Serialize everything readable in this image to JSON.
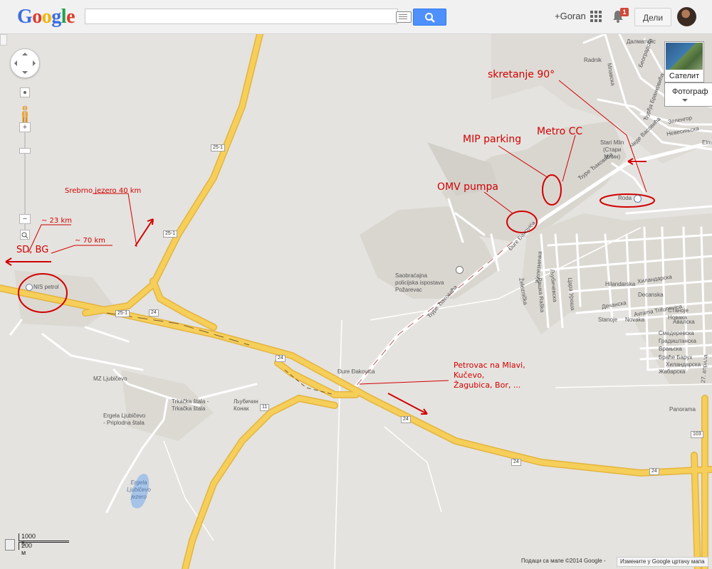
{
  "header": {
    "logo": [
      "G",
      "o",
      "o",
      "g",
      "l",
      "e"
    ],
    "logo_colors": [
      "#3b6ee0",
      "#dd3c2c",
      "#f2b400",
      "#3b6ee0",
      "#1ea34b",
      "#dd3c2c"
    ],
    "search_value": "",
    "profile": "+Goran",
    "notification_count": "1",
    "share_label": "Дели"
  },
  "controls": {
    "zoom_in": "+",
    "zoom_out": "−",
    "satellite_label": "Сателит",
    "photos_label": "Фотограф",
    "scale_imperial": "1000 ft",
    "scale_metric": "200 м"
  },
  "map_labels": {
    "radnik": "Radnik",
    "dalmatinska": "Далматинс",
    "mlavska": "Млавска",
    "beogradska": "Београдска",
    "jure_brankovica": "Ђурђа Бранковића",
    "stari_mlin": "Stari Mlin\n(Стари\nМлин)",
    "cede_vasovica": "Чеде Васовића",
    "nevesinjska": "Невесињска",
    "zelengorska": "Зеленгор",
    "elm": "Elm",
    "roda": "Roda",
    "ture_jakovica_1": "Ђуре Ђаковића",
    "ture_jakovica_2": "Đure Đakovića",
    "ture_jakovica_3": "Ђуре Ђаковића",
    "ture_jakovica_4": "Đure Đakovića",
    "saobracajna": "Saobraćajna\npolicijska ispostava\nPožarevac",
    "nis_petrol": "NIS petrol",
    "mz_ljubicevo": "MZ Ljubičevo",
    "trkacka": "Trkačka štala -\nTrkačka štala",
    "ljubicin_konak": "Љубичин\nКонак",
    "ergela_stala": "Ergela Ljubičevo\n- Priplodna štala",
    "ergela_jezero": "Ergela\nLjubičevo\njezero",
    "zeleznicka": "Železnička",
    "zeleznicka_cyr": "Железничка",
    "raska": "Рашка Raška",
    "ljubicevska": "Љубичевска",
    "cara_uros": "Цара Уроша",
    "hilandarska": "Hilandarska",
    "decanska": "Decanska",
    "dechanska": "Дечанска",
    "avram_trifunovic": "Avrama Trifunovica",
    "novaka": "Novaka",
    "stanoje": "Stanoje",
    "starine_novaka": "Старине Новака",
    "smederevska": "Смедеревска",
    "gradistanska": "Градиштанска",
    "vranjska": "Врањска",
    "brace_baruh": "Браће Барух",
    "hilandarska_cyr": "Хиландарска",
    "zabarska": "Жабарска",
    "avalska": "Авалска",
    "panorama": "Panorama",
    "april_27": "27. априла",
    "stanoje_hi": "Станоје\nНовака",
    "hilandarska2": "Хиландарска"
  },
  "road_shields": {
    "r25_1_a": "25-1",
    "r25_1_b": "25-1",
    "r25_1_c": "25-1",
    "r24_a": "24",
    "r24_b": "24",
    "r24_c": "24",
    "r24_d": "24",
    "r24_e": "24",
    "r11": "11",
    "r103": "103"
  },
  "annotations": {
    "skretanje": "skretanje 90°",
    "metro": "Metro CC",
    "mip": "MIP parking",
    "omv": "OMV pumpa",
    "srebrno": "Srebrno jezero 40 km",
    "km23": "~ 23 km",
    "km70": "~ 70 km",
    "sdbg": "SD, BG",
    "petrovac": "Petrovac na Mlavi,\nKučevo,\nŽagubica, Bor, ..."
  },
  "footer": {
    "map_data": "Подаци са мапе ©2014 Google -",
    "report": "Измените у Google цртачу мапа"
  },
  "colors": {
    "road_major": "#f6cf5a",
    "road_edge": "#e3b43e",
    "land": "#e5e3df",
    "annotation": "#d20000",
    "search_button": "#4d90fe"
  }
}
